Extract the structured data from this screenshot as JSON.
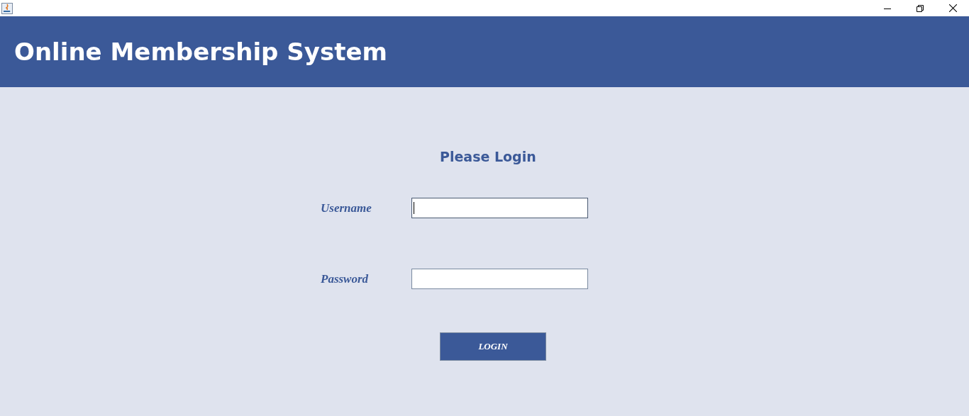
{
  "header": {
    "title": "Online Membership System"
  },
  "login": {
    "heading": "Please Login",
    "fields": [
      {
        "label": "Username",
        "focused": true
      },
      {
        "label": "Password",
        "focused": false
      }
    ],
    "button": "LOGIN"
  }
}
